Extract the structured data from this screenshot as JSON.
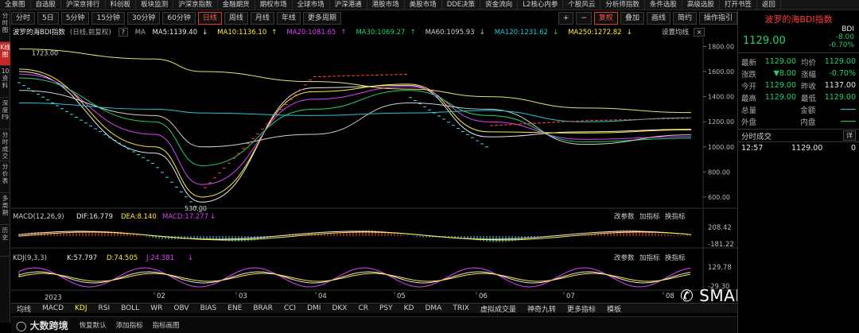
{
  "menu": [
    "全景图",
    "自选股",
    "沪深京排行",
    "科创板",
    "板块监测",
    "沪深京指数",
    "金融期货",
    "期权市场",
    "全球市场",
    "沪深港通",
    "港股市场",
    "美股市场",
    "DDE决策",
    "资金流向",
    "L2核心内参",
    "个股风云",
    "分析师指数",
    "条件选股",
    "高级选股",
    "打开书签",
    "返回"
  ],
  "leftrail": [
    {
      "label": "分时图"
    },
    {
      "label": "K线图",
      "active": true
    },
    {
      "label": "10资料"
    },
    {
      "label": "深度F9"
    },
    {
      "label": "分时成交"
    },
    {
      "label": "分价表"
    },
    {
      "label": "多周期"
    },
    {
      "label": "历史"
    }
  ],
  "toolbar": {
    "periods": [
      "分时",
      "5日",
      "5分钟",
      "15分钟",
      "30分钟",
      "60分钟",
      "日线",
      "周线",
      "月线",
      "年线",
      "更多周期"
    ],
    "active_period": "日线",
    "right": [
      "+",
      "−",
      "复权",
      "叠加",
      "画线",
      "简约",
      "操作指引"
    ]
  },
  "legend": {
    "title": "波罗的海BDI指数",
    "adj": "(日线,前复权)",
    "ma_label": "MA",
    "items": [
      {
        "text": "MA5:1139.40",
        "arrow": "↓",
        "color": "#e8e8e8"
      },
      {
        "text": "MA10:1136.10",
        "arrow": "↑",
        "color": "#ffeb3b"
      },
      {
        "text": "MA20:1081.65",
        "arrow": "↑",
        "color": "#e040fb"
      },
      {
        "text": "MA30:1069.27",
        "arrow": "↑",
        "color": "#22d36b"
      },
      {
        "text": "MA60:1095.93",
        "arrow": "↓",
        "color": "#cfcfcf"
      },
      {
        "text": "MA120:1231.62",
        "arrow": "↓",
        "color": "#24c6dc"
      },
      {
        "text": "MA250:1272.82",
        "arrow": "↓",
        "color": "#ffeb3b"
      }
    ],
    "settings": "设置均线"
  },
  "y_axis": [
    "1800.00",
    "1600.00",
    "1400.00",
    "1200.00",
    "1000.00",
    "800.00",
    "600.00"
  ],
  "annotations": {
    "high": "1723.00",
    "low": "530.00"
  },
  "macd": {
    "title": "MACD(12,26,9)",
    "dif": "DIF:16.779",
    "dea": "DEA:8.140",
    "macd": "MACD:17.277",
    "arrow": "↓",
    "btns": [
      "改参数",
      "加指标",
      "换指标"
    ],
    "top": "208.42",
    "bottom": "-181.22"
  },
  "kdj": {
    "title": "KDJ(9,3,3)",
    "k": "K:57.797",
    "d": "D:74.505",
    "j": "J:24.381",
    "arrow": "↓",
    "btns": [
      "改参数",
      "加指标",
      "换指标"
    ],
    "top": "129.78",
    "bottom": "-29.30"
  },
  "x_axis": {
    "year": "2023",
    "months": [
      "02",
      "03",
      "04",
      "05",
      "06",
      "07",
      "08"
    ]
  },
  "bottom_tabs": [
    "均线",
    "MACD",
    "KDJ",
    "RSI",
    "BOLL",
    "WR",
    "OBV",
    "BIAS",
    "ENE",
    "BRAR",
    "CCI",
    "DMI",
    "DKX",
    "CR",
    "PSY",
    "KD",
    "DMA",
    "TRIX",
    "虚拟成交量",
    "神奇九转",
    "更多指标",
    "模板"
  ],
  "watermark": "大数跨境",
  "brand": "SMARTRANS",
  "status": {
    "items": [
      "恢复默认",
      "添加指标",
      "指标画图"
    ]
  },
  "quote": {
    "name": "波罗的海BDI指数",
    "code": "BDI",
    "price": "1129.00",
    "change": "-8.00",
    "pct": "-0.70%",
    "rows": [
      {
        "l1": "最新",
        "v1": "1129.00",
        "c1": "green",
        "l2": "均价",
        "v2": "1129.00",
        "c2": "green"
      },
      {
        "l1": "涨跌",
        "v1": "▼8.00",
        "c1": "green",
        "l2": "涨幅",
        "v2": "-0.70%",
        "c2": "green"
      },
      {
        "l1": "今开",
        "v1": "1129.00",
        "c1": "green",
        "l2": "昨收",
        "v2": "1137.00",
        "c2": "white"
      },
      {
        "l1": "最高",
        "v1": "1129.00",
        "c1": "green",
        "l2": "最低",
        "v2": "1129.00",
        "c2": "green"
      },
      {
        "l1": "总量",
        "v1": "",
        "c1": "white",
        "l2": "金额",
        "v2": "",
        "c2": "white"
      },
      {
        "l1": "外盘",
        "v1": "",
        "c1": "red",
        "l2": "内盘",
        "v2": "",
        "c2": "green"
      }
    ],
    "trades_title": "分时成交",
    "trades_btn": "详",
    "trades": [
      {
        "time": "12:57",
        "price": "1129.00",
        "vol": "0"
      }
    ]
  },
  "chart_data": {
    "type": "line",
    "title": "波罗的海BDI指数",
    "ylim": [
      530,
      1860
    ],
    "x": [
      "2023-01",
      "2023-02",
      "2023-03",
      "2023-04",
      "2023-05",
      "2023-06",
      "2023-07",
      "2023-08"
    ],
    "series": [
      {
        "name": "MA5",
        "values": [
          1600,
          950,
          560,
          1470,
          1490,
          1080,
          1120,
          1140
        ]
      },
      {
        "name": "MA10",
        "values": [
          1620,
          1000,
          600,
          1440,
          1500,
          1120,
          1110,
          1136
        ]
      },
      {
        "name": "MA20",
        "values": [
          1580,
          1100,
          700,
          1380,
          1480,
          1200,
          1060,
          1082
        ]
      },
      {
        "name": "MA30",
        "values": [
          1550,
          1200,
          850,
          1300,
          1450,
          1250,
          1040,
          1069
        ]
      },
      {
        "name": "MA60",
        "values": [
          1450,
          1250,
          1000,
          1100,
          1350,
          1300,
          1020,
          1096
        ]
      },
      {
        "name": "MA120",
        "values": [
          1350,
          1300,
          1270,
          1250,
          1270,
          1290,
          1200,
          1232
        ]
      },
      {
        "name": "MA250",
        "values": [
          1780,
          1700,
          1600,
          1520,
          1460,
          1400,
          1310,
          1273
        ]
      }
    ],
    "high": 1723,
    "low": 530
  }
}
